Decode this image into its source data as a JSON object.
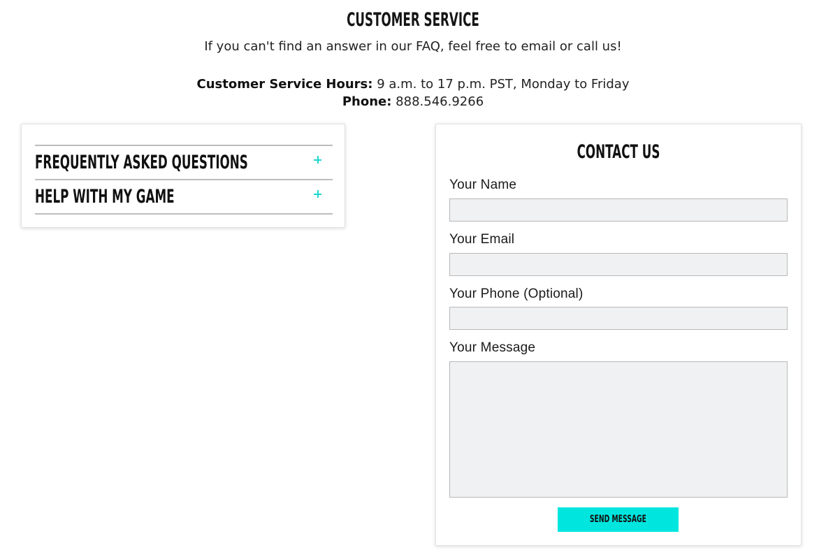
{
  "header": {
    "title": "CUSTOMER SERVICE",
    "intro": "If you can't find an answer in our FAQ, feel free to email or call us!",
    "hours_label": "Customer Service Hours:",
    "hours_value": " 9 a.m. to 17 p.m. PST, Monday to Friday",
    "phone_label": "Phone:",
    "phone_value": " 888.546.9266"
  },
  "faq": {
    "items": [
      {
        "label": "FREQUENTLY ASKED QUESTIONS",
        "icon": "plus-icon"
      },
      {
        "label": "HELP WITH MY GAME",
        "icon": "plus-icon"
      }
    ]
  },
  "contact": {
    "title": "CONTACT US",
    "name_label": "Your Name",
    "name_value": "",
    "email_label": "Your Email",
    "email_value": "",
    "phone_label": "Your Phone (Optional)",
    "phone_value": "",
    "message_label": "Your Message",
    "message_value": "",
    "submit_label": "SEND MESSAGE"
  },
  "colors": {
    "accent": "#00e6df",
    "plus_icon": "#1dd6cf",
    "input_background": "#f0f1f2",
    "divider": "#bdbdbd"
  }
}
